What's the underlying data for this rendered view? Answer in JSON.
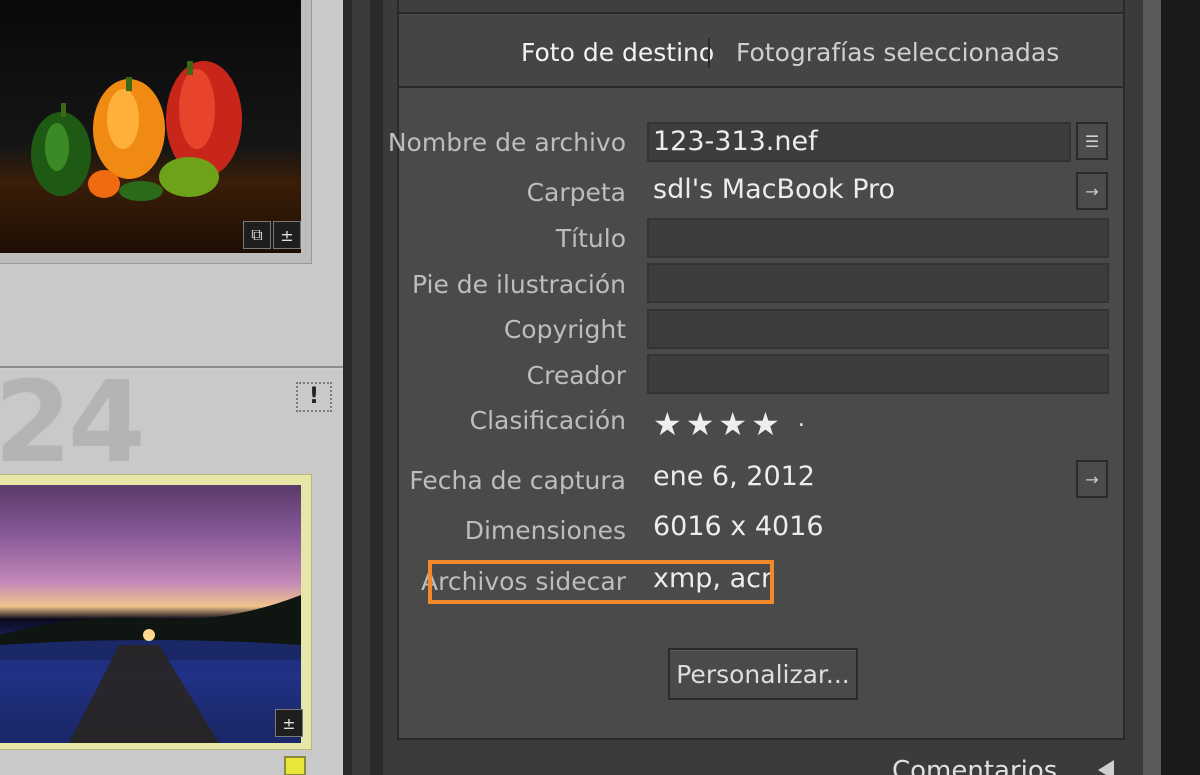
{
  "grid": {
    "cell_number": "24",
    "warning_badge": "!",
    "icons": [
      "crop-icon",
      "develop-adjust-icon"
    ]
  },
  "panel": {
    "tabs": [
      {
        "label": "Foto de destino",
        "active": true
      },
      {
        "label": "Fotografías seleccionadas",
        "active": false
      }
    ],
    "fields": {
      "filename_label": "Nombre de archivo",
      "filename_value": "123-313.nef",
      "folder_label": "Carpeta",
      "folder_value": "sdl's MacBook Pro",
      "title_label": "Título",
      "caption_label": "Pie de ilustración",
      "copyright_label": "Copyright",
      "creator_label": "Creador",
      "rating_label": "Clasificación",
      "rating_stars": "★★★★",
      "rating_dot": "·",
      "rating_value": 4,
      "capture_date_label": "Fecha de captura",
      "capture_date_value": "ene 6, 2012",
      "dimensions_label": "Dimensiones",
      "dimensions_value": "6016 x 4016",
      "sidecar_label": "Archivos sidecar",
      "sidecar_value": "xmp, acr"
    },
    "customize_button": "Personalizar..."
  },
  "bottom": {
    "section_label": "Comentarios"
  },
  "colors": {
    "highlight": "#f28a2b",
    "panel_bg": "#4a4a4a",
    "flag_yellow": "#e9e63a"
  }
}
